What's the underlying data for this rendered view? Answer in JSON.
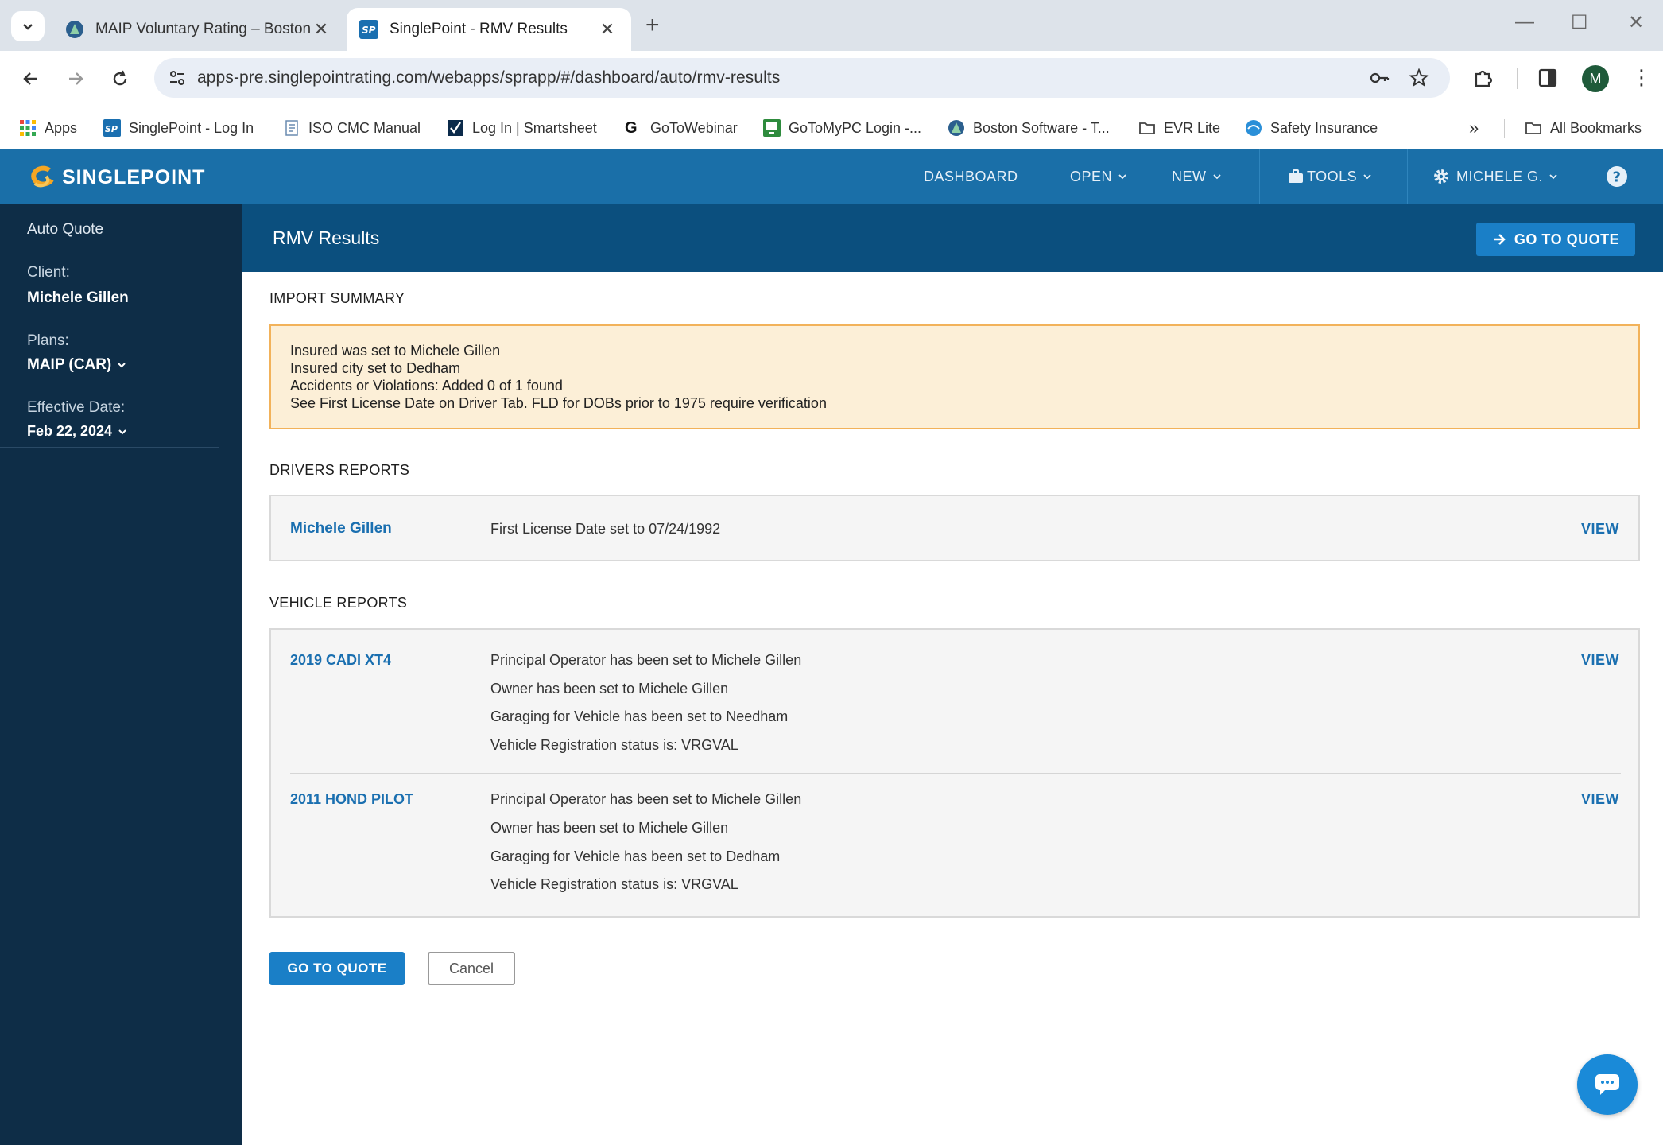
{
  "browser": {
    "tabs": [
      {
        "title": "MAIP Voluntary Rating – Boston"
      },
      {
        "title": "SinglePoint - RMV Results"
      }
    ],
    "url": "apps-pre.singlepointrating.com/webapps/sprapp/#/dashboard/auto/rmv-results",
    "profile_initial": "M",
    "bookmarks": [
      "Apps",
      "SinglePoint - Log In",
      "ISO CMC Manual",
      "Log In | Smartsheet",
      "GoToWebinar",
      "GoToMyPC Login -...",
      "Boston Software - T...",
      "EVR Lite",
      "Safety Insurance"
    ],
    "all_bookmarks": "All Bookmarks"
  },
  "app": {
    "logo": "SINGLEPOINT",
    "nav": {
      "dashboard": "DASHBOARD",
      "open": "OPEN",
      "new": "NEW",
      "tools": "TOOLS",
      "user": "MICHELE G."
    },
    "accent_color": "#1a6fa8"
  },
  "sidebar": {
    "section": "Auto Quote",
    "client_label": "Client:",
    "client_value": "Michele Gillen",
    "plans_label": "Plans:",
    "plans_value": "MAIP (CAR)",
    "effective_label": "Effective Date:",
    "effective_value": "Feb 22, 2024"
  },
  "page": {
    "title": "RMV Results",
    "go_to_quote_top": "GO TO QUOTE"
  },
  "import_summary": {
    "title": "IMPORT SUMMARY",
    "lines": [
      "Insured was set to Michele Gillen",
      "Insured city set to Dedham",
      "Accidents or Violations: Added 0 of 1 found",
      "See First License Date on Driver Tab. FLD for DOBs prior to 1975 require verification"
    ]
  },
  "drivers_reports": {
    "title": "DRIVERS REPORTS",
    "rows": [
      {
        "name": "Michele Gillen",
        "text": "First License Date set to 07/24/1992",
        "action": "VIEW"
      }
    ]
  },
  "vehicle_reports": {
    "title": "VEHICLE REPORTS",
    "rows": [
      {
        "name": "2019 CADI XT4",
        "lines": [
          "Principal Operator has been set to Michele Gillen",
          "Owner has been set to Michele Gillen",
          "Garaging for Vehicle has been set to Needham",
          "Vehicle Registration status is: VRGVAL"
        ],
        "action": "VIEW"
      },
      {
        "name": "2011 HOND PILOT",
        "lines": [
          "Principal Operator has been set to Michele Gillen",
          "Owner has been set to Michele Gillen",
          "Garaging for Vehicle has been set to Dedham",
          "Vehicle Registration status is: VRGVAL"
        ],
        "action": "VIEW"
      }
    ]
  },
  "footer_buttons": {
    "go_to_quote": "GO TO QUOTE",
    "cancel": "Cancel"
  }
}
